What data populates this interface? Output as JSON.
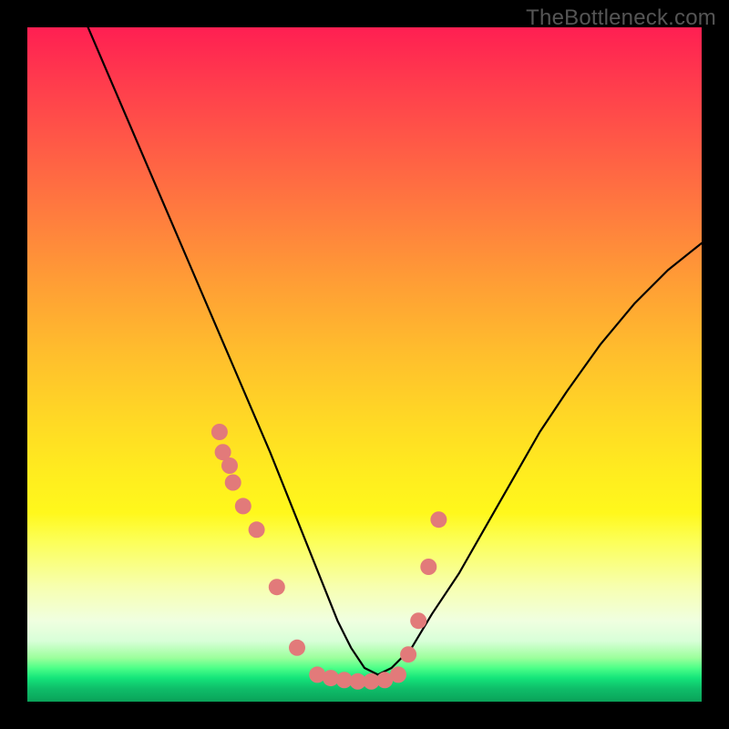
{
  "watermark": "TheBottleneck.com",
  "chart_data": {
    "type": "line",
    "title": "",
    "xlabel": "",
    "ylabel": "",
    "xlim": [
      0,
      100
    ],
    "ylim": [
      0,
      100
    ],
    "series": [
      {
        "name": "bottleneck-curve",
        "x": [
          9,
          12,
          15,
          18,
          21,
          24,
          27,
          30,
          33,
          36,
          38,
          40,
          42,
          44,
          46,
          48,
          50,
          52,
          54,
          57,
          60,
          64,
          68,
          72,
          76,
          80,
          85,
          90,
          95,
          100
        ],
        "y": [
          100,
          93,
          86,
          79,
          72,
          65,
          58,
          51,
          44,
          37,
          32,
          27,
          22,
          17,
          12,
          8,
          5,
          4,
          5,
          8,
          13,
          19,
          26,
          33,
          40,
          46,
          53,
          59,
          64,
          68
        ]
      }
    ],
    "markers": {
      "name": "gpu-data-points",
      "color": "#e27a7a",
      "x": [
        28.5,
        29.0,
        30.0,
        30.5,
        32.0,
        34.0,
        37.0,
        40.0,
        43.0,
        45.0,
        47.0,
        49.0,
        51.0,
        53.0,
        55.0,
        56.5,
        58.0,
        59.5,
        61.0
      ],
      "y": [
        40.0,
        37.0,
        35.0,
        32.5,
        29.0,
        25.5,
        17.0,
        8.0,
        4.0,
        3.5,
        3.2,
        3.0,
        3.0,
        3.2,
        4.0,
        7.0,
        12.0,
        20.0,
        27.0
      ]
    }
  }
}
